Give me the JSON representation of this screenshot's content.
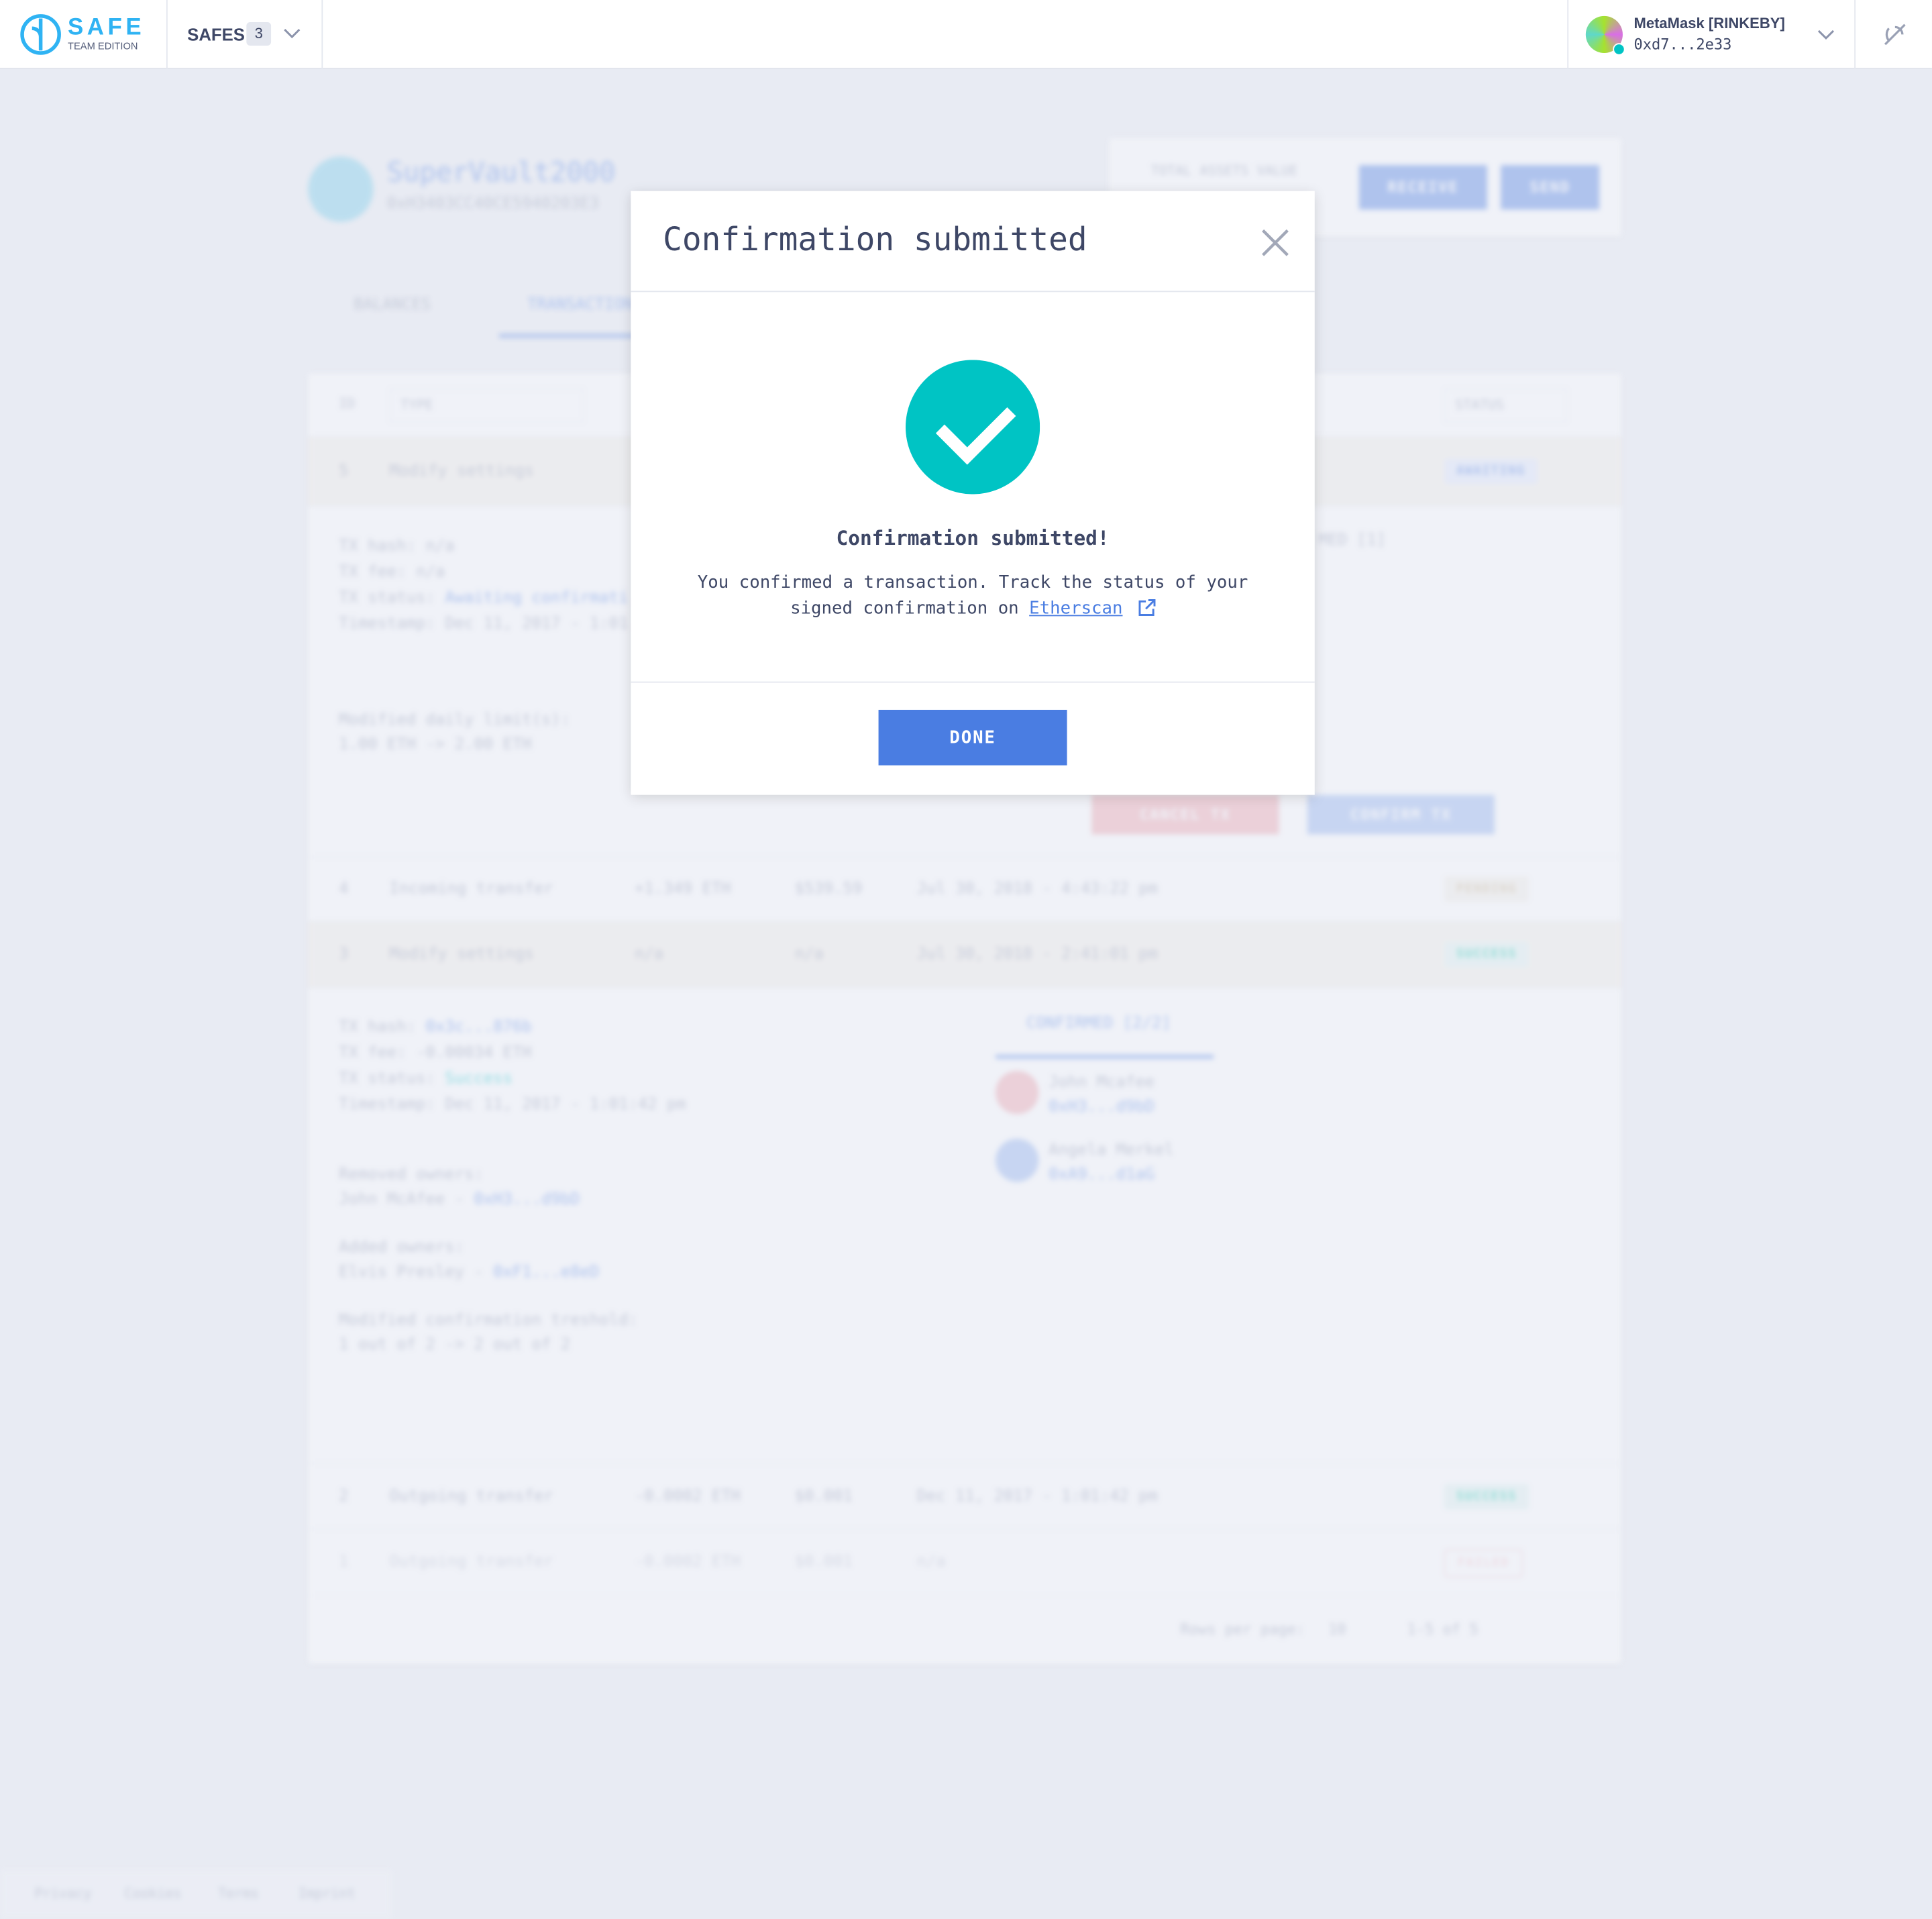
{
  "header": {
    "logo_text": "SAFE",
    "logo_sub": "TEAM EDITION",
    "safes_label": "SAFES",
    "safes_count": "3",
    "wallet_name": "MetaMask [RINKEBY]",
    "wallet_address": "0xd7...2e33",
    "colors": {
      "brand": "#2fb3f3",
      "wallet_status": "#00c4c4"
    }
  },
  "safe": {
    "name": "SuperVault2000",
    "address": "0xH3403CC40CE5940203E3",
    "total_label": "TOTAL ASSETS VALUE",
    "receive": "RECEIVE",
    "send": "SEND"
  },
  "tabs": [
    {
      "label": "BALANCES"
    },
    {
      "label": "TRANSACTIONS",
      "active": true
    }
  ],
  "table": {
    "headers": {
      "id": "ID",
      "type": "TYPE",
      "status": "STATUS"
    },
    "rows": [
      {
        "id": "5",
        "type": "Modify settings",
        "amount": "",
        "value": "",
        "date": "",
        "status": "AWAITING"
      },
      {
        "id": "4",
        "type": "Incoming transfer",
        "amount": "+1.349 ETH",
        "value": "$539.59",
        "date": "Jul 30, 2018 - 4:43:22 pm",
        "status": "PENDING"
      },
      {
        "id": "3",
        "type": "Modify settings",
        "amount": "n/a",
        "value": "n/a",
        "date": "Jul 30, 2018 - 2:41:01 pm",
        "status": "SUCCESS"
      },
      {
        "id": "2",
        "type": "Outgoing transfer",
        "amount": "-0.0002 ETH",
        "value": "$0.001",
        "date": "Dec 11, 2017 - 1:01:42 pm",
        "status": "SUCCESS"
      },
      {
        "id": "1",
        "type": "Outgoing transfer",
        "amount": "-0.0002 ETH",
        "value": "$0.001",
        "date": "n/a",
        "status": "FAILED"
      }
    ],
    "row5_details": {
      "hash": "TX hash: n/a",
      "fee": "TX fee: n/a",
      "status_label": "TX status: ",
      "status": "Awaiting confirmati",
      "timestamp": "Timestamp: Dec 11, 2017 - 1:01",
      "limit_label": "Modified daily limit(s):",
      "limit": "1.00 ETH -> 2.00 ETH",
      "confirmed": "MED [1]",
      "cancel": "CANCEL TX",
      "confirm": "CONFIRM TX"
    },
    "row3_details": {
      "hash_label": "TX hash: ",
      "hash": "0x3c...876b",
      "fee": "TX fee: -0.00034 ETH",
      "status_label": "TX status: ",
      "status": "Success",
      "timestamp": "Timestamp: Dec 11, 2017 - 1:01:42 pm",
      "removed_label": "Removed owners:",
      "removed": "John McAfee - ",
      "removed_addr": "0xH3...d9bD",
      "added_label": "Added owners:",
      "added": "Elvis Presley - ",
      "added_addr": "0xF1...e8eD",
      "threshold_label": "Modified confirmation treshold:",
      "threshold": "1 out of 2 -> 2 out of 2",
      "confirmed_tab": "CONFIRMED [2/2]",
      "owners": [
        {
          "name": "John Mcafee",
          "addr": "0xH3...d9bD"
        },
        {
          "name": "Angela Merkel",
          "addr": "0xA9...d1aG"
        }
      ]
    },
    "pagination": {
      "rows_label": "Rows per page:",
      "rows_value": "10",
      "range": "1-5 of 5"
    }
  },
  "footer": [
    "Privacy",
    "Cookies",
    "Terms",
    "Imprint"
  ],
  "modal": {
    "title": "Confirmation submitted",
    "heading": "Confirmation submitted!",
    "body_line1": "You confirmed a transaction. Track the status of your",
    "body_line2": "signed confirmation on ",
    "link": "Etherscan",
    "done": "DONE",
    "colors": {
      "success": "#00c4c4",
      "primary": "#4a7de2"
    }
  }
}
